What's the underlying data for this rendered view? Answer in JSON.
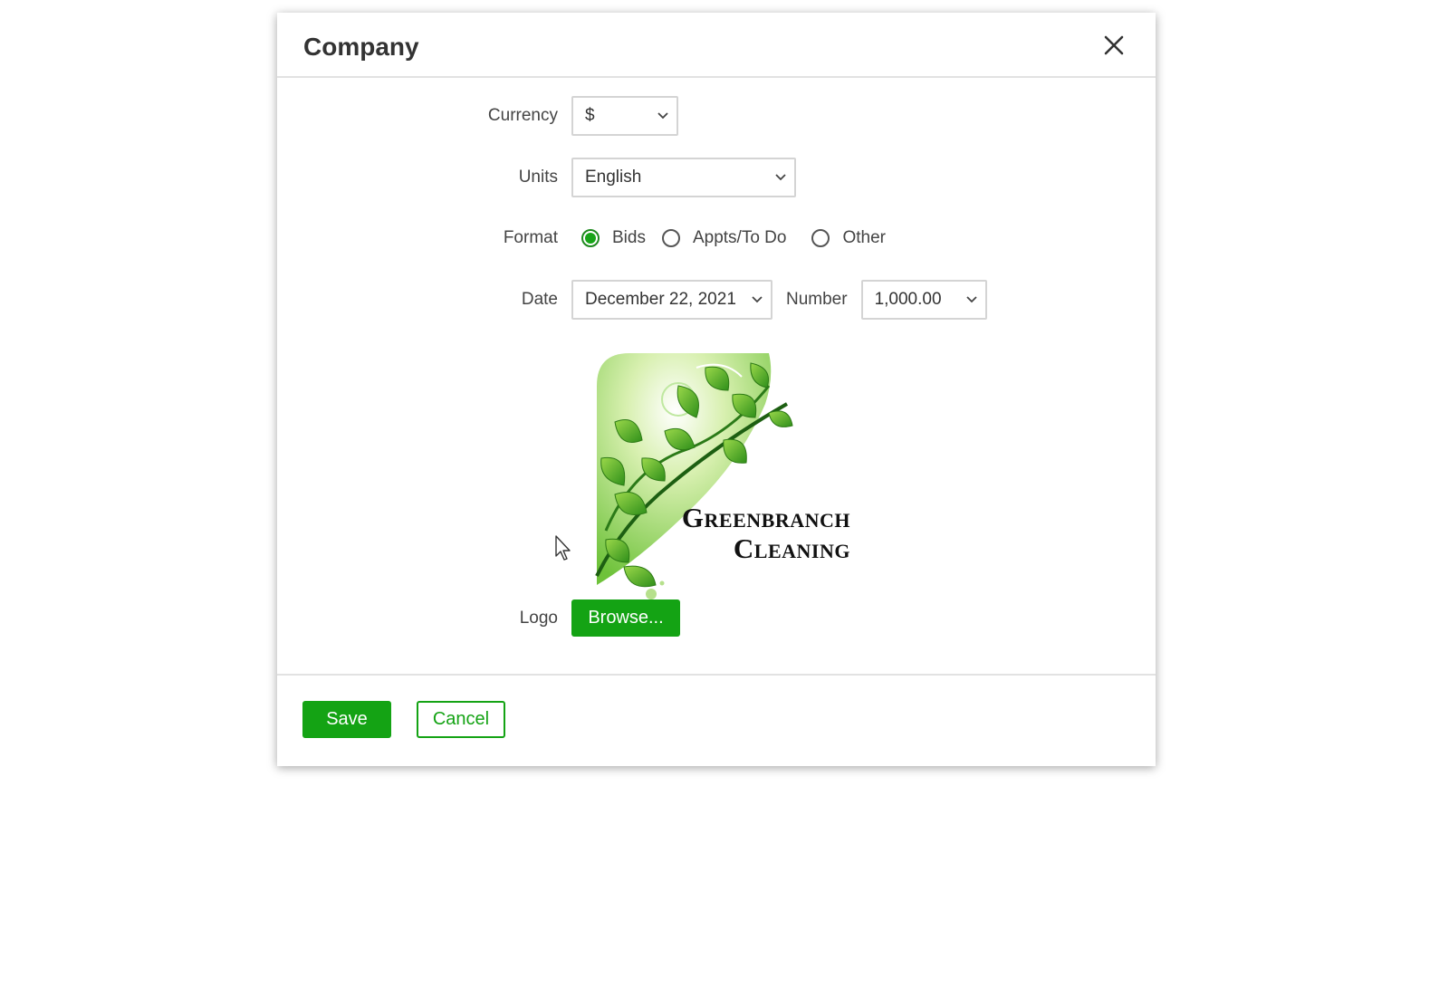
{
  "dialog": {
    "title": "Company",
    "close_icon": "close-icon"
  },
  "form": {
    "currency": {
      "label": "Currency",
      "value": "$"
    },
    "units": {
      "label": "Units",
      "value": "English"
    },
    "format": {
      "label": "Format",
      "options": [
        {
          "label": "Bids",
          "selected": true
        },
        {
          "label": "Appts/To Do",
          "selected": false
        },
        {
          "label": "Other",
          "selected": false
        }
      ]
    },
    "date": {
      "label": "Date",
      "value": "December 22, 2021"
    },
    "number": {
      "label": "Number",
      "value": "1,000.00"
    },
    "logo": {
      "label": "Logo",
      "browse_label": "Browse...",
      "brand_line1": "Greenbranch",
      "brand_line2": "Cleaning"
    }
  },
  "footer": {
    "save_label": "Save",
    "cancel_label": "Cancel"
  },
  "colors": {
    "accent": "#14a314",
    "border": "#d4d4d4"
  }
}
